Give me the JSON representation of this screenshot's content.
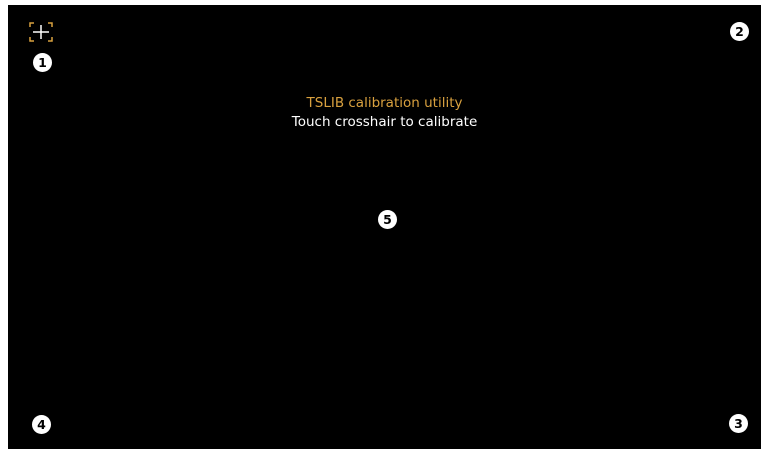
{
  "header": {
    "title": "TSLIB calibration utility",
    "subtitle": "Touch crosshair to calibrate"
  },
  "crosshair": {
    "icon": "crosshair-icon",
    "color": "#d9a13f"
  },
  "markers": [
    {
      "label": "1"
    },
    {
      "label": "2"
    },
    {
      "label": "3"
    },
    {
      "label": "4"
    },
    {
      "label": "5"
    }
  ],
  "colors": {
    "background": "#000000",
    "accent": "#d9a13f",
    "text": "#ffffff"
  }
}
